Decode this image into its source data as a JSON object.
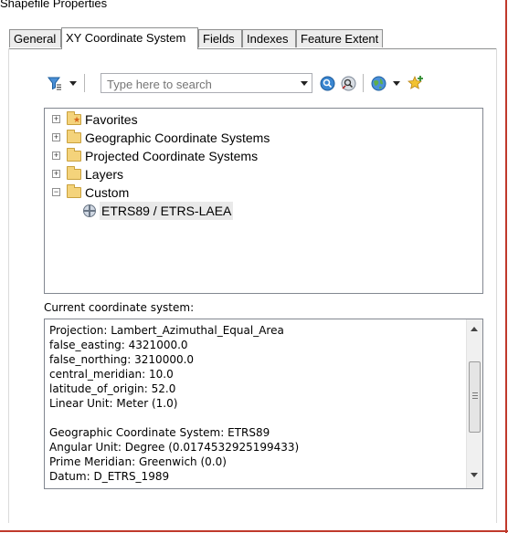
{
  "window": {
    "title": "Shapefile Properties"
  },
  "tabs": [
    {
      "label": "General"
    },
    {
      "label": "XY Coordinate System"
    },
    {
      "label": "Fields"
    },
    {
      "label": "Indexes"
    },
    {
      "label": "Feature Extent"
    }
  ],
  "active_tab": "XY Coordinate System",
  "toolbar": {
    "filter_icon": "filter-icon",
    "search_placeholder": "Type here to search",
    "search_value": "",
    "search_icon": "search-icon",
    "clear_search_icon": "clear-search-icon",
    "globe_icon": "globe-icon",
    "add_favorite_icon": "add-favorite-icon"
  },
  "tree": {
    "items": [
      {
        "label": "Favorites",
        "icon": "favorites-folder-icon",
        "expanded": false
      },
      {
        "label": "Geographic Coordinate Systems",
        "icon": "folder-icon",
        "expanded": false
      },
      {
        "label": "Projected Coordinate Systems",
        "icon": "folder-icon",
        "expanded": false
      },
      {
        "label": "Layers",
        "icon": "folder-icon",
        "expanded": false
      },
      {
        "label": "Custom",
        "icon": "open-folder-icon",
        "expanded": true
      }
    ],
    "children": [
      {
        "label": "ETRS89 / ETRS-LAEA",
        "icon": "globe-icon",
        "selected": true
      }
    ]
  },
  "current": {
    "label": "Current coordinate system:",
    "lines": [
      "Projection: Lambert_Azimuthal_Equal_Area",
      "false_easting: 4321000.0",
      "false_northing: 3210000.0",
      "central_meridian: 10.0",
      "latitude_of_origin: 52.0",
      "Linear Unit: Meter (1.0)",
      "",
      "Geographic Coordinate System: ETRS89",
      "Angular Unit: Degree (0.0174532925199433)",
      "Prime Meridian: Greenwich (0.0)",
      "Datum: D_ETRS_1989"
    ]
  },
  "colors": {
    "accent_border": "#c0392b",
    "selection_bg": "#e9e9e9",
    "folder": "#f4d37b"
  }
}
